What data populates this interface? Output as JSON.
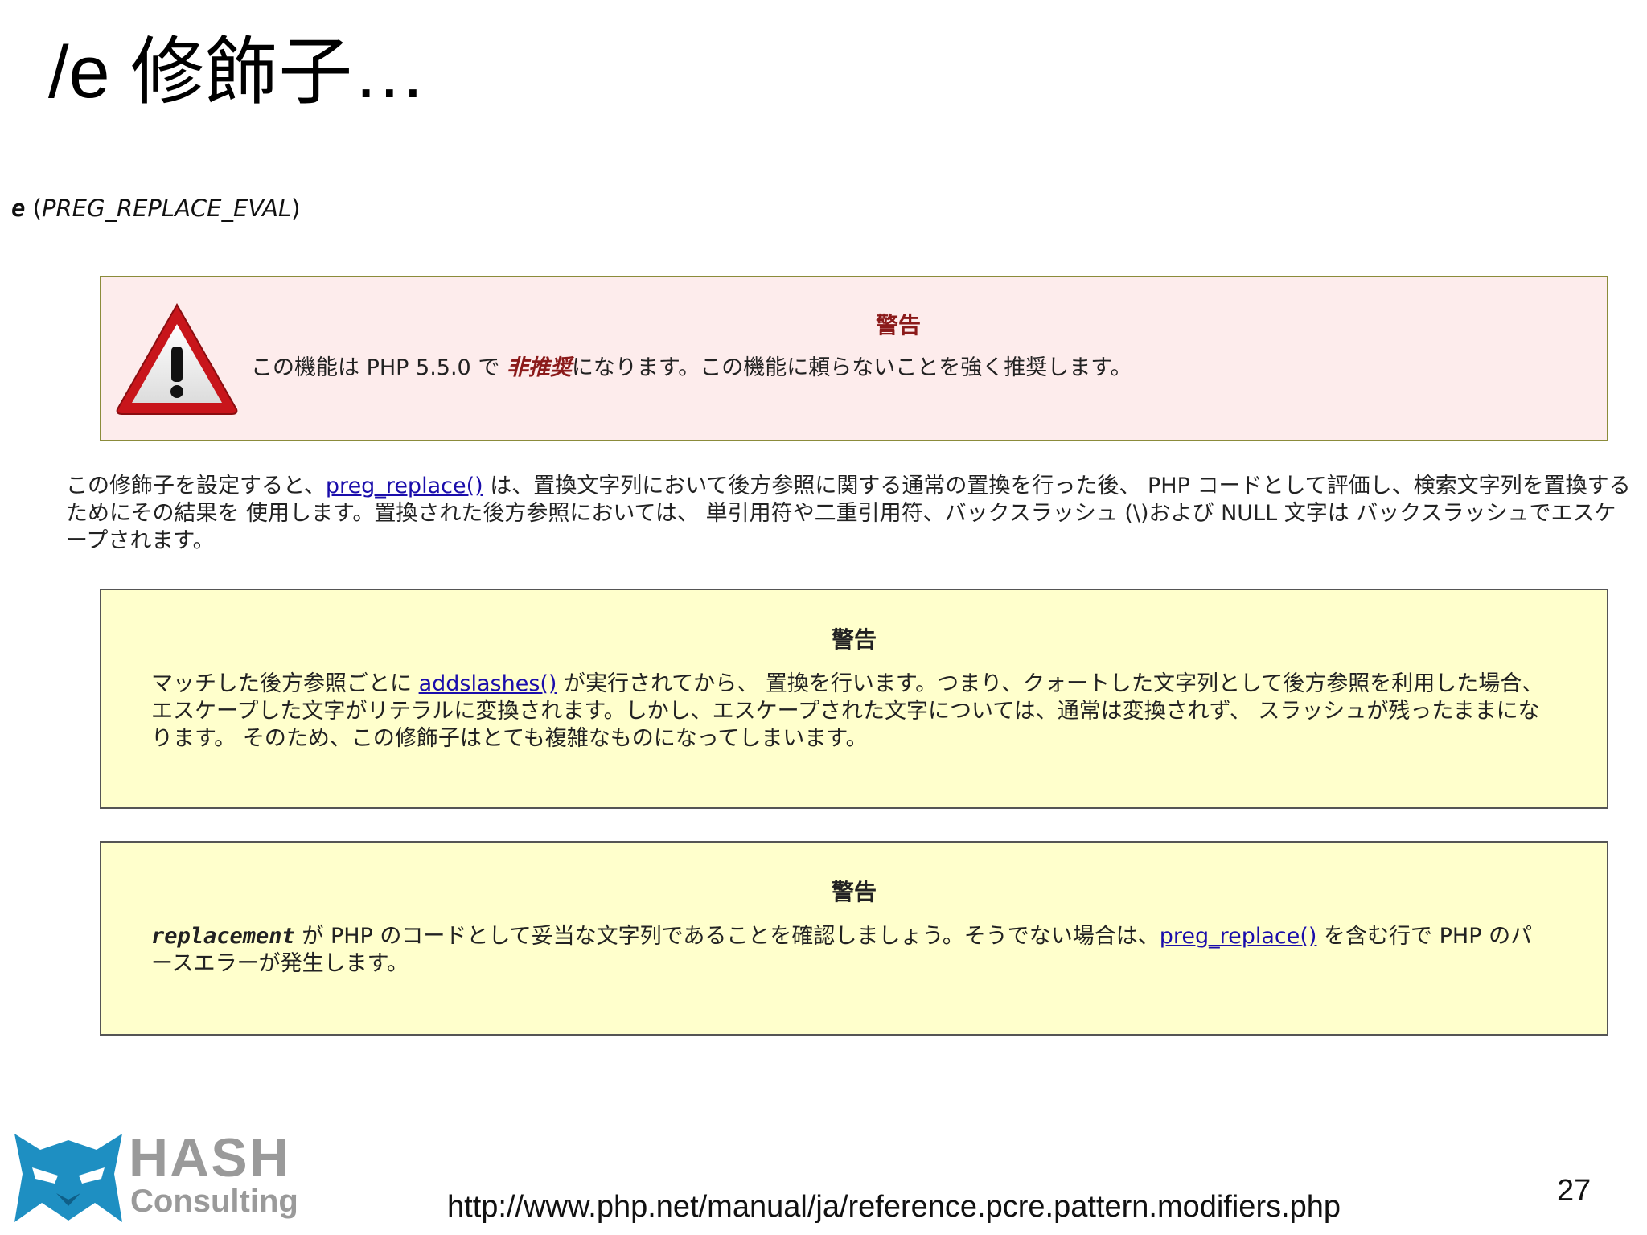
{
  "slide": {
    "title": "/e 修飾子…",
    "page_number": "27",
    "source_url": "http://www.php.net/manual/ja/reference.pcre.pattern.modifiers.php"
  },
  "modifier": {
    "code": "e",
    "open_paren": " (",
    "constant": "PREG_REPLACE_EVAL",
    "close_paren": ")"
  },
  "deprecated_box": {
    "title": "警告",
    "text_before": "この機能は PHP 5.5.0 で ",
    "emphasis": "非推奨",
    "text_after": "になります。この機能に頼らないことを強く推奨します。",
    "icon": "warning-triangle-icon"
  },
  "description": {
    "text_before": "この修飾子を設定すると、",
    "link": "preg_replace()",
    "text_after": " は、置換文字列において後方参照に関する通常の置換を行った後、 PHP コードとして評価し、検索文字列を置換するためにその結果を 使用します。置換された後方参照においては、 単引用符や二重引用符、バックスラッシュ (\\)および NULL 文字は バックスラッシュでエスケープされます。"
  },
  "warning_1": {
    "title": "警告",
    "text_before": "マッチした後方参照ごとに ",
    "link": "addslashes()",
    "text_after": " が実行されてから、 置換を行います。つまり、クォートした文字列として後方参照を利用した場合、 エスケープした文字がリテラルに変換されます。しかし、エスケープされた文字については、通常は変換されず、 スラッシュが残ったままになります。 そのため、この修飾子はとても複雑なものになってしまいます。"
  },
  "warning_2": {
    "title": "警告",
    "code": "replacement",
    "text_before": " が PHP のコードとして妥当な文字列であることを確認しましょう。そうでない場合は、",
    "link": "preg_replace()",
    "text_after": " を含む行で PHP のパースエラーが発生します。"
  },
  "logo": {
    "word1": "HASH",
    "word2": "Consulting",
    "icon": "ninja-mask-icon",
    "colors": {
      "mask": "#1e8fc2",
      "text": "#9a9a9a"
    }
  },
  "colors": {
    "deprecated_bg": "#fdecec",
    "warning_bg": "#ffffcc",
    "link": "#1a0dab",
    "deprecated_accent": "#8b1a1a"
  }
}
